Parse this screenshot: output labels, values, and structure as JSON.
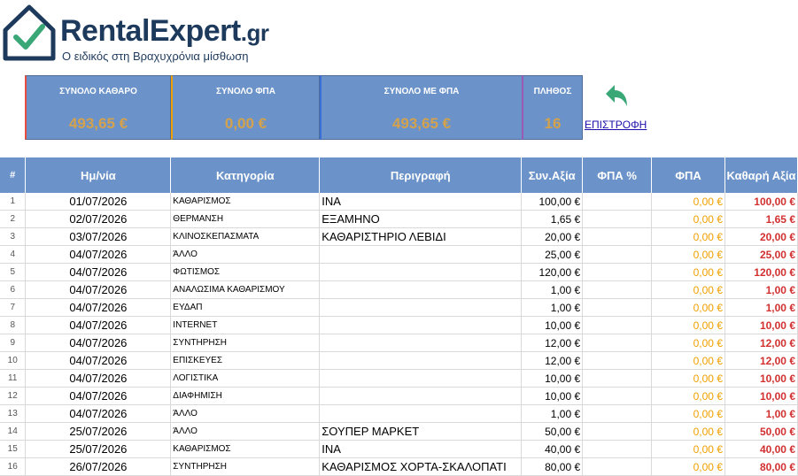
{
  "brand": {
    "name": "RentalExpert",
    "tld": ".gr",
    "tagline": "Ο ειδικός στη Βραχυχρόνια μίσθωση"
  },
  "summary": [
    {
      "label": "ΣΥΝΟΛΟ ΚΑΘΑΡΟ",
      "value": "493,65 €"
    },
    {
      "label": "ΣΥΝΟΛΟ ΦΠΑ",
      "value": "0,00 €"
    },
    {
      "label": "ΣΥΝΟΛΟ ΜΕ ΦΠΑ",
      "value": "493,65 €"
    },
    {
      "label": "ΠΛΗΘΟΣ",
      "value": "16"
    }
  ],
  "back_link": "ΕΠΙΣΤΡΟΦΗ",
  "colors": {
    "header_bg": "#6b93c9",
    "vat": "#f0a000",
    "net": "#d23030",
    "brand": "#1d3a5c",
    "check": "#3aa876"
  },
  "columns": [
    "#",
    "Ημ/νία",
    "Κατηγορία",
    "Περιγραφή",
    "Συν.Αξία",
    "ΦΠΑ %",
    "ΦΠΑ",
    "Καθαρή Αξία"
  ],
  "rows": [
    [
      "1",
      "01/07/2026",
      "ΚΑΘΑΡΙΣΜΟΣ",
      "ΙΝΑ",
      "100,00 €",
      "",
      "0,00 €",
      "100,00 €"
    ],
    [
      "2",
      "02/07/2026",
      "ΘΕΡΜΑΝΣΗ",
      "ΕΞΑΜΗΝΟ",
      "1,65 €",
      "",
      "0,00 €",
      "1,65 €"
    ],
    [
      "3",
      "03/07/2026",
      "ΚΛΙΝΟΣΚΕΠΑΣΜΑΤΑ",
      "ΚΑΘΑΡΙΣΤΗΡΙΟ ΛΕΒΙΔΙ",
      "20,00 €",
      "",
      "0,00 €",
      "20,00 €"
    ],
    [
      "4",
      "04/07/2026",
      "ΆΛΛΟ",
      "",
      "25,00 €",
      "",
      "0,00 €",
      "25,00 €"
    ],
    [
      "5",
      "04/07/2026",
      "ΦΩΤΙΣΜΟΣ",
      "",
      "120,00 €",
      "",
      "0,00 €",
      "120,00 €"
    ],
    [
      "6",
      "04/07/2026",
      "ΑΝΑΛΩΣΙΜΑ ΚΑΘΑΡΙΣΜΟΥ",
      "",
      "1,00 €",
      "",
      "0,00 €",
      "1,00 €"
    ],
    [
      "7",
      "04/07/2026",
      "ΕΥΔΑΠ",
      "",
      "1,00 €",
      "",
      "0,00 €",
      "1,00 €"
    ],
    [
      "8",
      "04/07/2026",
      "INTERNET",
      "",
      "10,00 €",
      "",
      "0,00 €",
      "10,00 €"
    ],
    [
      "9",
      "04/07/2026",
      "ΣΥΝΤΗΡΗΣΗ",
      "",
      "12,00 €",
      "",
      "0,00 €",
      "12,00 €"
    ],
    [
      "10",
      "04/07/2026",
      "ΕΠΙΣΚΕΥΕΣ",
      "",
      "12,00 €",
      "",
      "0,00 €",
      "12,00 €"
    ],
    [
      "11",
      "04/07/2026",
      "ΛΟΓΙΣΤΙΚΑ",
      "",
      "10,00 €",
      "",
      "0,00 €",
      "10,00 €"
    ],
    [
      "12",
      "04/07/2026",
      "ΔΙΑΦΗΜΙΣΗ",
      "",
      "10,00 €",
      "",
      "0,00 €",
      "10,00 €"
    ],
    [
      "13",
      "04/07/2026",
      "ΆΛΛΟ",
      "",
      "1,00 €",
      "",
      "0,00 €",
      "1,00 €"
    ],
    [
      "14",
      "25/07/2026",
      "ΆΛΛΟ",
      "ΣΟΥΠΕΡ ΜΑΡΚΕΤ",
      "50,00 €",
      "",
      "0,00 €",
      "50,00 €"
    ],
    [
      "15",
      "25/07/2026",
      "ΚΑΘΑΡΙΣΜΟΣ",
      "ΙΝΑ",
      "40,00 €",
      "",
      "0,00 €",
      "40,00 €"
    ],
    [
      "16",
      "26/07/2026",
      "ΣΥΝΤΗΡΗΣΗ",
      "ΚΑΘΑΡΙΣΜΟΣ ΧΟΡΤΑ-ΣΚΑΛΟΠΑΤΙ",
      "80,00 €",
      "",
      "0,00 €",
      "80,00 €"
    ]
  ]
}
